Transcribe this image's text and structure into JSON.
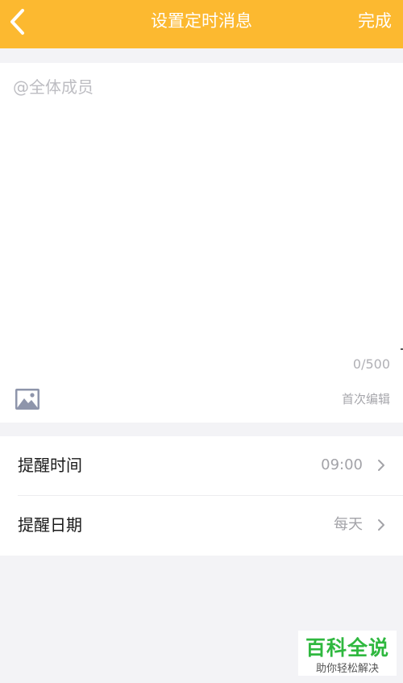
{
  "header": {
    "title": "设置定时消息",
    "done_label": "完成"
  },
  "editor": {
    "content": "@全体成员",
    "char_count": "0/500",
    "first_edit_label": "首次编辑"
  },
  "settings": {
    "rows": [
      {
        "label": "提醒时间",
        "value": "09:00"
      },
      {
        "label": "提醒日期",
        "value": "每天"
      }
    ]
  },
  "watermark": {
    "title": "百科全说",
    "subtitle": "助你轻松解决"
  },
  "icons": {
    "back": "chevron-left-icon",
    "image": "image-icon",
    "row_arrow": "chevron-right-icon"
  },
  "colors": {
    "header_bg": "#fcb930",
    "page_bg": "#f3f3f6",
    "watermark_green": "#2fb83f"
  }
}
